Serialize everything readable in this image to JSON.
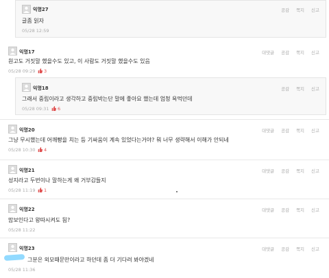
{
  "actions": {
    "reply": "대댓글",
    "like": "공감",
    "message": "쪽지",
    "report": "신고"
  },
  "comments": [
    {
      "name": "익명27",
      "text": "글좀 읽자",
      "date": "05/28 12:59",
      "likes": null,
      "nested": true
    },
    {
      "name": "익명17",
      "text": "원고도 거짓말 했을수도 있고, 이 사람도 거짓말 했을수도 있음",
      "date": "05/28 09:29",
      "likes": "3",
      "nested": false
    },
    {
      "name": "익명18",
      "text": "그래서 중립이라고 생각하고 중립박는단 말에 좋아요 했는데 엄청 욕먹던데",
      "date": "05/28 09:31",
      "likes": "6",
      "nested": true
    },
    {
      "name": "익명20",
      "text": "그냥 무시했는데 어깨빵을 치는 등 기싸움이 계속 있었다는거야? 뭐 너무 생략해서 이해가 안되네",
      "date": "05/28 10:30",
      "likes": "4",
      "nested": false
    },
    {
      "name": "익명21",
      "text": "성지라고 두번이나 말하는게 왜 거부감들지",
      "date": "05/28 11:19",
      "likes": "1",
      "nested": false
    },
    {
      "name": "익명22",
      "text": "맙보인다고 왕따시켜도 됨?",
      "date": "05/28 11:22",
      "likes": null,
      "nested": false
    },
    {
      "name": "익명23",
      "text": "그분은 외모때문만이라고 하던데 좀 더 기다려 봐야겠네",
      "date": "05/28 11:36",
      "likes": null,
      "nested": false
    }
  ],
  "colors": {
    "like": "#e05050",
    "meta": "#aaaaaa",
    "reply_bg": "#f8f8f8"
  }
}
